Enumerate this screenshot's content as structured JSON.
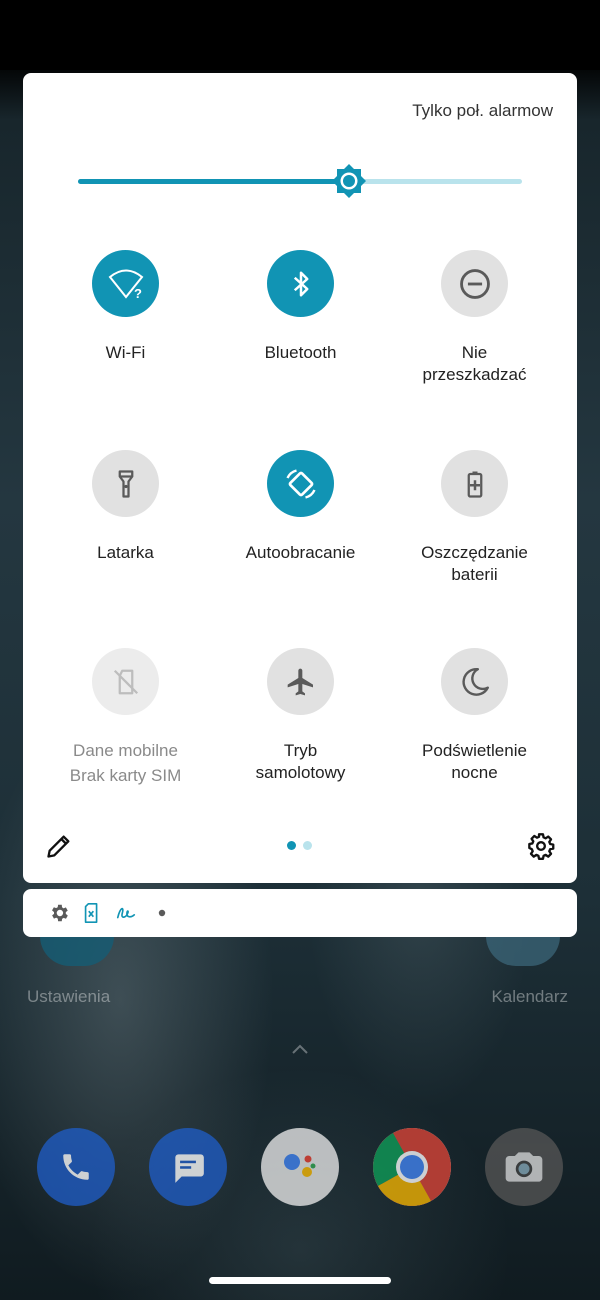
{
  "header": {
    "dnd_status": "Tylko poł. alarmow"
  },
  "brightness": {
    "level_fraction": 0.61
  },
  "tiles": [
    {
      "label_lines": [
        "Wi-Fi"
      ],
      "state": "on",
      "icon": "wifi-question-icon"
    },
    {
      "label_lines": [
        "Bluetooth"
      ],
      "state": "on",
      "icon": "bluetooth-icon"
    },
    {
      "label_lines": [
        "Nie",
        "przeszkadzać"
      ],
      "state": "off",
      "icon": "do-not-disturb-icon"
    },
    {
      "label_lines": [
        "Latarka"
      ],
      "state": "off",
      "icon": "flashlight-icon"
    },
    {
      "label_lines": [
        "Autoobracanie"
      ],
      "state": "on",
      "icon": "auto-rotate-icon"
    },
    {
      "label_lines": [
        "Oszczędzanie",
        "baterii"
      ],
      "state": "off",
      "icon": "battery-saver-icon"
    },
    {
      "label_lines": [
        "Dane mobilne",
        "Brak karty SIM"
      ],
      "state": "disabled",
      "icon": "no-sim-icon"
    },
    {
      "label_lines": [
        "Tryb",
        "samolotowy"
      ],
      "state": "off",
      "icon": "airplane-icon"
    },
    {
      "label_lines": [
        "Podświetlenie",
        "nocne"
      ],
      "state": "off",
      "icon": "night-light-icon"
    }
  ],
  "pager": {
    "pages": 2,
    "active": 0
  },
  "notifications": {
    "icons": [
      "gear-icon",
      "sim-card-x-icon",
      "signature-icon",
      "more-dot-icon"
    ]
  },
  "home": {
    "apps": {
      "left_label": "Ustawienia",
      "right_label": "Kalendarz"
    },
    "dock": [
      "phone-icon",
      "messages-icon",
      "assistant-icon",
      "chrome-icon",
      "camera-icon"
    ]
  },
  "colors": {
    "accent": "#1194b4",
    "accent_light": "#b9e3ec",
    "tile_off": "#e1e1e1"
  }
}
